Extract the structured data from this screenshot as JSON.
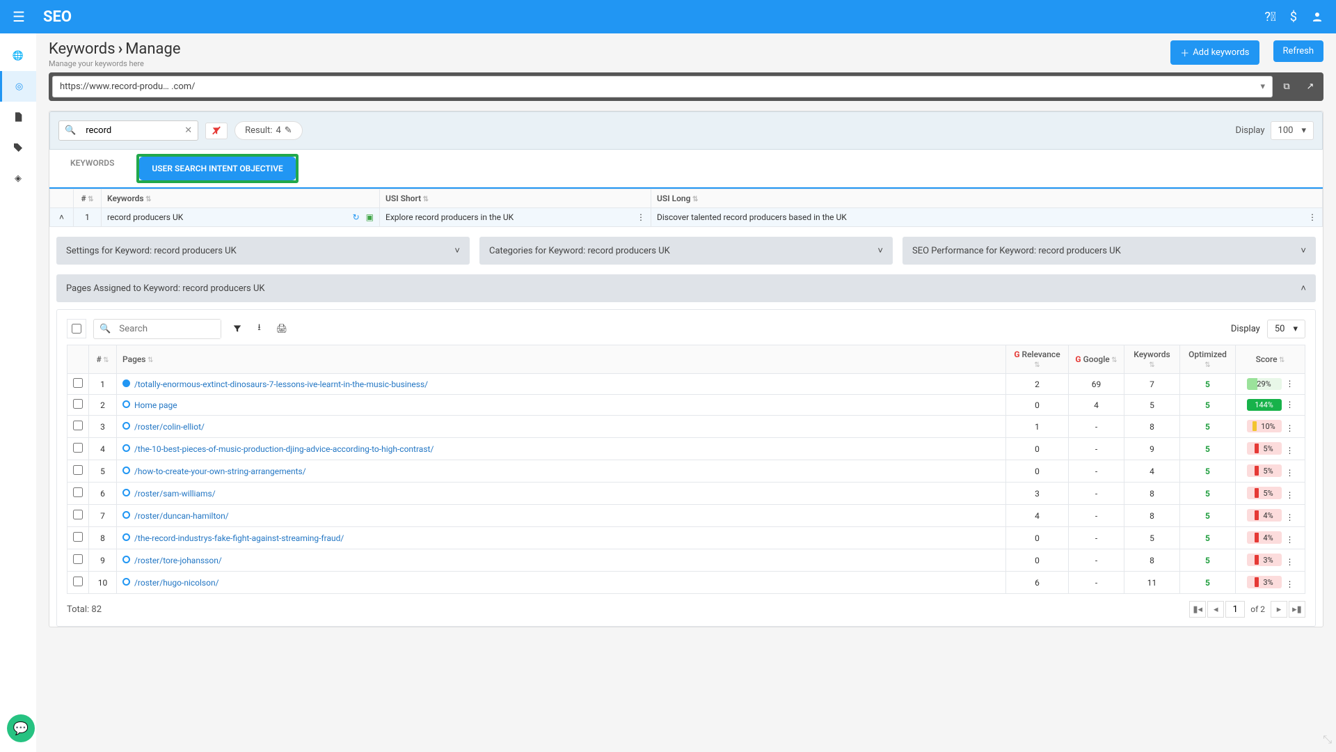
{
  "header": {
    "brand": "SEO",
    "crumb1": "Keywords",
    "crumb2": "Manage",
    "sub": "Manage your keywords here",
    "add_btn": "Add keywords",
    "refresh_btn": "Refresh"
  },
  "urlbar": {
    "url": "https://www.record-produ…  .com/"
  },
  "filter": {
    "search_value": "record",
    "result_label": "Result:",
    "result_count": "4",
    "display_label": "Display",
    "display_value": "100"
  },
  "tabs": {
    "keywords": "KEYWORDS",
    "usi": "USER SEARCH INTENT OBJECTIVE"
  },
  "kw_table": {
    "cols": {
      "num": "#",
      "keywords": "Keywords",
      "usi_short": "USI Short",
      "usi_long": "USI Long"
    },
    "row": {
      "num": "1",
      "keyword": "record producers UK",
      "usi_short": "Explore record producers in the UK",
      "usi_long": "Discover talented record producers based in the UK"
    }
  },
  "accordions": {
    "settings": "Settings for Keyword: record producers UK",
    "categories": "Categories for Keyword: record producers UK",
    "seo": "SEO Performance for Keyword: record producers UK",
    "pages_assigned": "Pages Assigned to Keyword: record producers UK"
  },
  "pages": {
    "search_placeholder": "Search",
    "display_label": "Display",
    "display_value": "50",
    "cols": {
      "num": "#",
      "pages": "Pages",
      "relevance": "Relevance",
      "google": "Google",
      "keywords": "Keywords",
      "optimized": "Optimized",
      "score": "Score"
    },
    "rows": [
      {
        "n": "1",
        "status": "filled",
        "page": "/totally-enormous-extinct-dinosaurs-7-lessons-ive-learnt-in-the-music-business/",
        "rel": "2",
        "goog": "69",
        "kw": "7",
        "opt": "5",
        "score": "29%",
        "sclass": "score-29"
      },
      {
        "n": "2",
        "status": "open",
        "page": "Home page",
        "rel": "0",
        "goog": "4",
        "kw": "5",
        "opt": "5",
        "score": "144%",
        "sclass": "score-144"
      },
      {
        "n": "3",
        "status": "open",
        "page": "/roster/colin-elliot/",
        "rel": "1",
        "goog": "-",
        "kw": "8",
        "opt": "5",
        "score": "10%",
        "sclass": "score-low",
        "bar": "bar-y"
      },
      {
        "n": "4",
        "status": "open",
        "page": "/the-10-best-pieces-of-music-production-djing-advice-according-to-high-contrast/",
        "rel": "0",
        "goog": "-",
        "kw": "9",
        "opt": "5",
        "score": "5%",
        "sclass": "score-low",
        "bar": "bar-r"
      },
      {
        "n": "5",
        "status": "open",
        "page": "/how-to-create-your-own-string-arrangements/",
        "rel": "0",
        "goog": "-",
        "kw": "4",
        "opt": "5",
        "score": "5%",
        "sclass": "score-low",
        "bar": "bar-r"
      },
      {
        "n": "6",
        "status": "open",
        "page": "/roster/sam-williams/",
        "rel": "3",
        "goog": "-",
        "kw": "8",
        "opt": "5",
        "score": "5%",
        "sclass": "score-low",
        "bar": "bar-r"
      },
      {
        "n": "7",
        "status": "open",
        "page": "/roster/duncan-hamilton/",
        "rel": "4",
        "goog": "-",
        "kw": "8",
        "opt": "5",
        "score": "4%",
        "sclass": "score-low",
        "bar": "bar-r"
      },
      {
        "n": "8",
        "status": "open",
        "page": "/the-record-industrys-fake-fight-against-streaming-fraud/",
        "rel": "0",
        "goog": "-",
        "kw": "5",
        "opt": "5",
        "score": "4%",
        "sclass": "score-low",
        "bar": "bar-r"
      },
      {
        "n": "9",
        "status": "open",
        "page": "/roster/tore-johansson/",
        "rel": "0",
        "goog": "-",
        "kw": "8",
        "opt": "5",
        "score": "3%",
        "sclass": "score-low",
        "bar": "bar-r"
      },
      {
        "n": "10",
        "status": "open",
        "page": "/roster/hugo-nicolson/",
        "rel": "6",
        "goog": "-",
        "kw": "11",
        "opt": "5",
        "score": "3%",
        "sclass": "score-low",
        "bar": "bar-r"
      }
    ],
    "total_label": "Total:",
    "total_value": "82",
    "pager": {
      "page": "1",
      "of_label": "of",
      "of_total": "2"
    }
  }
}
